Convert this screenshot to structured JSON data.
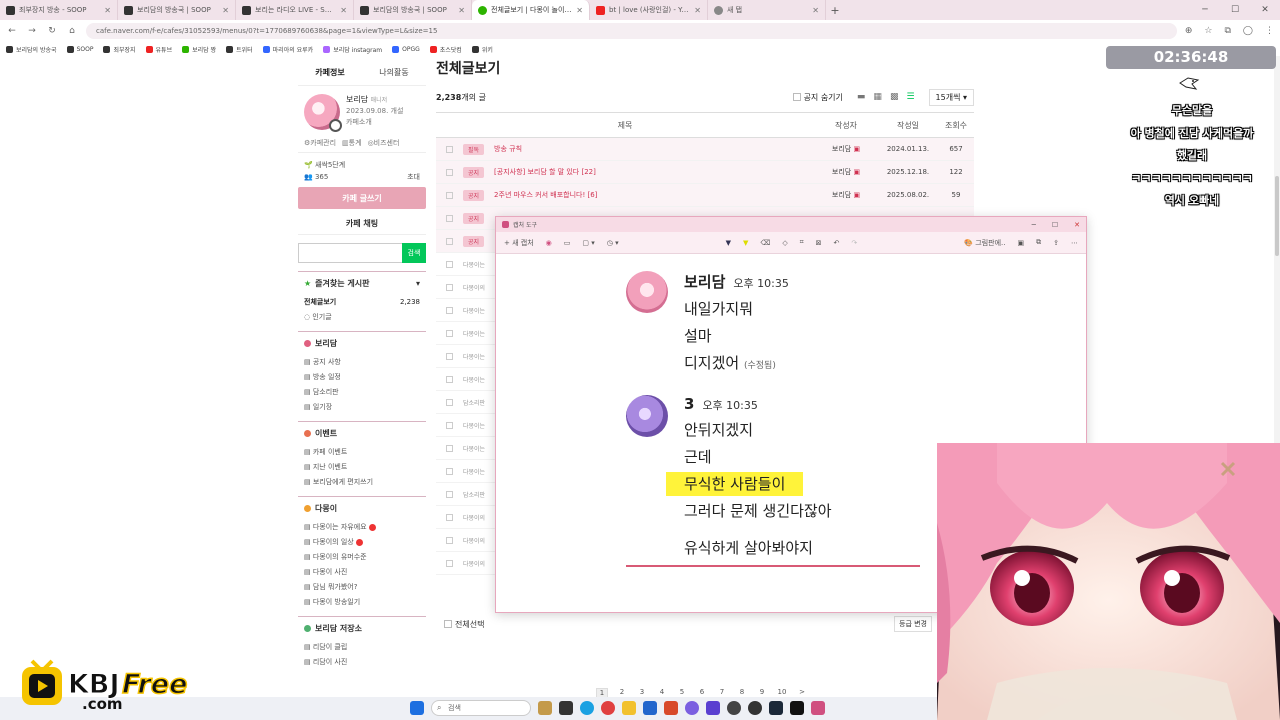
{
  "browser": {
    "tabs": [
      {
        "title": "죄부장지 방송 - SOOP",
        "fav": "soop"
      },
      {
        "title": "보리담의 방송국 | SOOP",
        "fav": "soop"
      },
      {
        "title": "보리는 라디오 LIVE - SOOP",
        "fav": "soop"
      },
      {
        "title": "보리담의 방송국 | SOOP",
        "fav": "soop"
      },
      {
        "title": "전체글보기 | 다몽이 놀이터 : 네",
        "fav": "naver"
      },
      {
        "title": "bt | love (사랑인걸) - YouTube",
        "fav": "youtube"
      },
      {
        "title": "새 탭",
        "fav": "newtab"
      }
    ],
    "url": "cafe.naver.com/f-e/cafes/31052593/menus/0?t=1770689760638&page=1&viewType=L&size=15",
    "bookmarks": [
      "보리담의 방송국",
      "SOOP",
      "죄부장지",
      "유튜브",
      "보리담 짱",
      "트위터",
      "마리아의 요루카",
      "보리담 instagram",
      "OPGG",
      "초스닷컴",
      "위키"
    ]
  },
  "sidebar": {
    "tab_info": "카페정보",
    "tab_activity": "나의활동",
    "profile_name": "보리담",
    "profile_role": "매니저",
    "profile_since": "2023.09.08. 개설",
    "profile_intro": "카페소개",
    "mgmt": [
      "카페관리",
      "통계",
      "비즈센터"
    ],
    "level": "새싹5단계",
    "members": "365",
    "invite": "초대",
    "write_label": "카페 글쓰기",
    "chat_label": "카페 채팅",
    "search_btn": "검색",
    "fav_section": "즐겨찾는 게시판",
    "all_posts": "전체글보기",
    "all_posts_count": "2,238",
    "popular": "인기글",
    "sections": [
      {
        "title": "보리담",
        "items": [
          "공지 사항",
          "방송 일정",
          "담소리판",
          "일기장"
        ]
      },
      {
        "title": "이벤트",
        "items": [
          "카페 이벤트",
          "지난 이벤트",
          "보리담에게 편지쓰기"
        ]
      },
      {
        "title": "다몽이",
        "items": [
          "다몽이는 자유에요",
          "다몽이의 일상",
          "다몽이의 유머수준",
          "다몽이 사진",
          "담님 뭐가봤어?",
          "다몽이 방송일기"
        ]
      },
      {
        "title": "보리담 저장소",
        "items": [
          "리담이 클립",
          "리담이 사진"
        ]
      }
    ]
  },
  "board": {
    "title": "전체글보기",
    "count_num": "2,238",
    "count_suffix": "개의 글",
    "notice_hide": "공지 숨기기",
    "page_size": "15개씩",
    "col_title": "제목",
    "col_author": "작성자",
    "col_date": "작성일",
    "col_views": "조회수",
    "notices": [
      {
        "badge": "필독",
        "title": "방송 규칙",
        "author": "보리담",
        "date": "2024.01.13.",
        "views": "657"
      },
      {
        "badge": "공지",
        "title": "[공지사항] 보리담 할 말 있다 [22]",
        "author": "보리담",
        "date": "2025.12.18.",
        "views": "122"
      },
      {
        "badge": "공지",
        "title": "2주년 마우스 커서 배포합니다! [6]",
        "author": "보리담",
        "date": "2025.08.02.",
        "views": "59"
      }
    ],
    "rows_cat": [
      "다몽이는",
      "다몽이의",
      "다몽이는",
      "다몽이는",
      "다몽이는",
      "다몽이는",
      "담소리판",
      "다몽이는",
      "다몽이는",
      "다몽이는",
      "담소리판",
      "다몽이의",
      "다몽이의",
      "다몽이의"
    ],
    "select_all": "전체선택",
    "grade_change": "등급 변경",
    "pages": [
      "1",
      "2",
      "3",
      "4",
      "5",
      "6",
      "7",
      "8",
      "9",
      "10",
      ">"
    ]
  },
  "capture": {
    "title": "캡처 도구",
    "new_capture": "+ 새 캡처",
    "edit_with": "그림판에..",
    "messages": [
      {
        "name": "보리담",
        "time": "오후 10:35",
        "lines": [
          "내일가지뭐",
          "설마",
          "디지겠어"
        ],
        "edited": "(수정됨)"
      },
      {
        "name": "3",
        "time": "오후 10:35",
        "lines": [
          "안뒤지겠지",
          "근데",
          "무식한 사람들이",
          "그러다 문제 생긴다잖아",
          "유식하게 살아봐야지"
        ]
      }
    ]
  },
  "overlay": {
    "timer": "02:36:48",
    "lines": [
      "무슨말을",
      "아 병철에 진담 사케먹을까",
      "했길래",
      "ㅋㅋㅋㅋㅋㅋㅋㅋㅋㅋㅋㅋ",
      "역시 오빠네"
    ]
  },
  "taskbar": {
    "search": "검색"
  },
  "watermark": {
    "line1": "KBJ",
    "line2": "Free",
    "line3": ".com"
  },
  "colors": {
    "accent": "#e8a5b5",
    "naver_green": "#03c75a",
    "highlight": "#fff33a"
  }
}
